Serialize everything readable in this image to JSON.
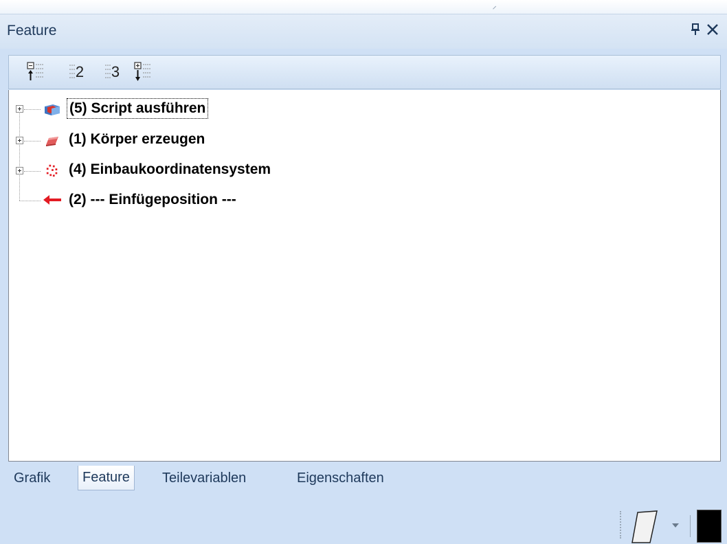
{
  "panel": {
    "title": "Feature",
    "pin_icon": "pin-icon",
    "close_icon": "close-icon"
  },
  "toolbar": {
    "buttons": [
      {
        "name": "collapse-up-button",
        "icon": "collapse-up-icon"
      },
      {
        "name": "level-2-button",
        "icon": "level-icon",
        "label": "2"
      },
      {
        "name": "level-3-button",
        "icon": "level-icon",
        "label": "3"
      },
      {
        "name": "expand-down-button",
        "icon": "expand-down-icon"
      }
    ]
  },
  "tree": {
    "items": [
      {
        "label": "(5) Script ausführen",
        "icon": "script-icon",
        "expandable": true,
        "focused": true
      },
      {
        "label": "(1) Körper erzeugen",
        "icon": "body-icon",
        "expandable": true,
        "focused": false
      },
      {
        "label": "(4) Einbaukoordinatensystem",
        "icon": "coordinate-system-icon",
        "expandable": true,
        "focused": false
      },
      {
        "label": "(2) --- Einfügeposition ---",
        "icon": "insert-arrow-icon",
        "expandable": false,
        "focused": false
      }
    ]
  },
  "tabs": [
    {
      "label": "Grafik",
      "active": false
    },
    {
      "label": "Feature",
      "active": true
    },
    {
      "label": "Teilevariablen",
      "active": false
    },
    {
      "label": "Eigenschaften",
      "active": false
    }
  ],
  "statusbar": {
    "shape_icon": "parallelogram-icon",
    "dropdown_icon": "dropdown-arrow-icon",
    "color_swatch": "#000000"
  },
  "colors": {
    "header_text": "#1e395b",
    "accent_red": "#e31b23"
  }
}
